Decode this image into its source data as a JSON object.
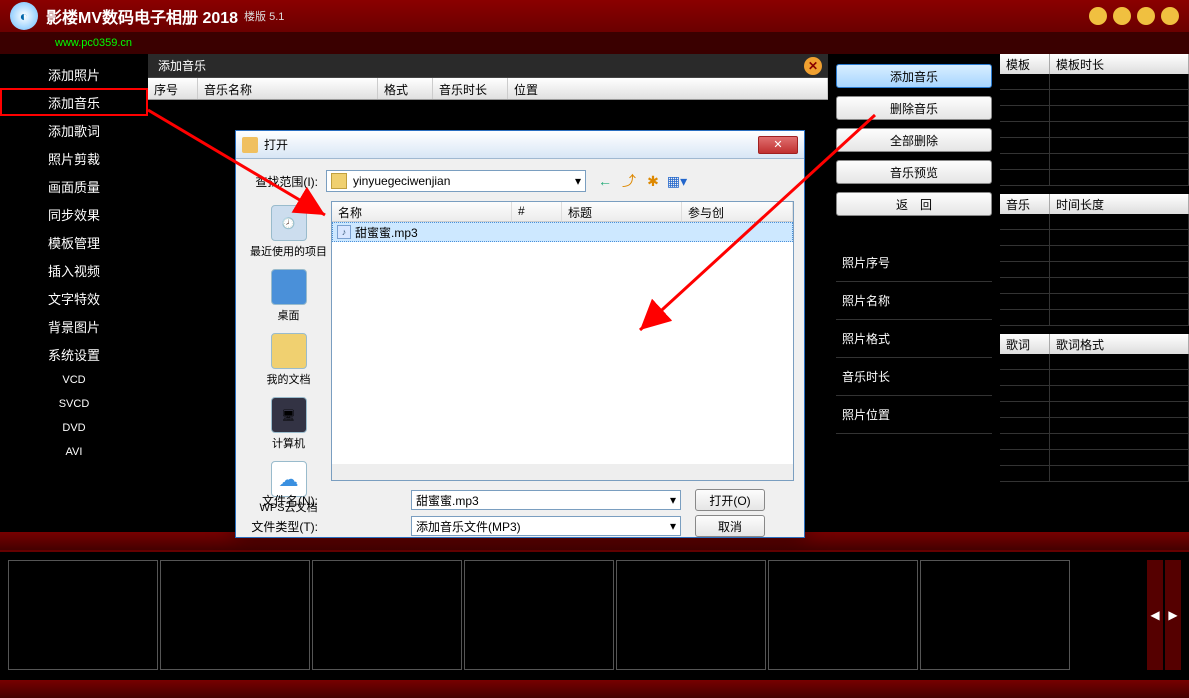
{
  "title": "影楼MV数码电子相册 2018",
  "version_suffix": "楼版 5.1",
  "watermark": "www.pc0359.cn",
  "sidebar": {
    "items": [
      "添加照片",
      "添加音乐",
      "添加歌词",
      "照片剪裁",
      "画面质量",
      "同步效果",
      "模板管理",
      "插入视频",
      "文字特效",
      "背景图片",
      "系统设置"
    ],
    "small_items": [
      "VCD",
      "SVCD",
      "DVD",
      "AVI"
    ],
    "highlighted_index": 1
  },
  "music_tab": {
    "title": "添加音乐",
    "columns": {
      "seq": "序号",
      "name": "音乐名称",
      "format": "格式",
      "duration": "音乐时长",
      "location": "位置"
    }
  },
  "actions": {
    "add": "添加音乐",
    "remove": "删除音乐",
    "remove_all": "全部删除",
    "preview": "音乐预览",
    "back": "返　回"
  },
  "info_labels": {
    "photo_seq": "照片序号",
    "photo_name": "照片名称",
    "photo_format": "照片格式",
    "music_duration": "音乐时长",
    "photo_location": "照片位置"
  },
  "right_tables": {
    "t1": {
      "c1": "模板",
      "c2": "模板时长"
    },
    "t2": {
      "c1": "音乐",
      "c2": "时间长度"
    },
    "t3": {
      "c1": "歌词",
      "c2": "歌词格式"
    }
  },
  "dialog": {
    "title": "打开",
    "range_label": "查找范围(I):",
    "folder": "yinyuegeciwenjian",
    "nav": {
      "back": "←",
      "up": "↑",
      "new": "📁",
      "view": "▦"
    },
    "places": {
      "recent": "最近使用的项目",
      "desktop": "桌面",
      "mydocs": "我的文档",
      "computer": "计算机",
      "wps": "WPS云文档"
    },
    "cols": {
      "name": "名称",
      "num": "#",
      "title": "标题",
      "artist": "参与创"
    },
    "file": {
      "name": "甜蜜蜜.mp3"
    },
    "filename_label": "文件名(N):",
    "filename_value": "甜蜜蜜.mp3",
    "filetype_label": "文件类型(T):",
    "filetype_value": "添加音乐文件(MP3)",
    "open_btn": "打开(O)",
    "cancel_btn": "取消"
  }
}
